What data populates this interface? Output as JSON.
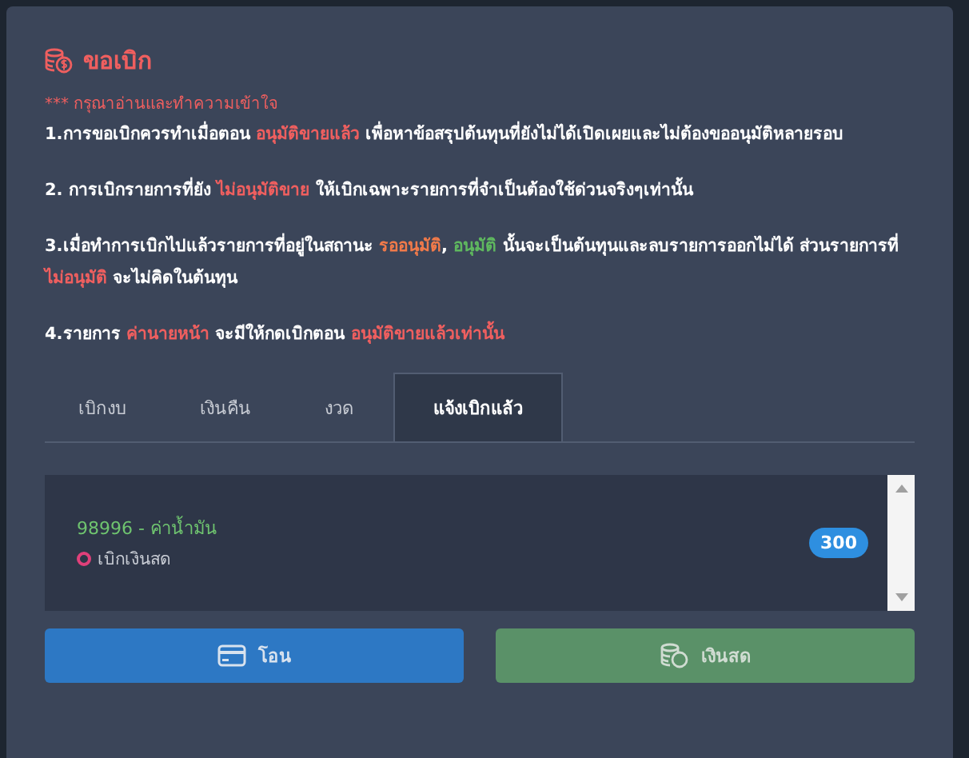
{
  "modal": {
    "title": "ขอเบิก",
    "warning": "*** กรุณาอ่านและทำความเข้าใจ",
    "notes": [
      {
        "parts": [
          {
            "text": "1.การขอเบิกควรทำเมื่อตอน "
          },
          {
            "text": "อนุมัติขายแล้ว",
            "color": "#ef5f5f"
          },
          {
            "text": " เพื่อหาข้อสรุปต้นทุนที่ยังไม่ได้เปิดเผยและไม่ต้องขออนุมัติหลายรอบ"
          }
        ]
      },
      {
        "parts": [
          {
            "text": "2. การเบิกรายการที่ยัง "
          },
          {
            "text": "ไม่อนุมัติขาย",
            "color": "#ef5f5f"
          },
          {
            "text": " ให้เบิกเฉพาะรายการที่จำเป็นต้องใช้ด่วนจริงๆเท่านั้น"
          }
        ]
      },
      {
        "parts": [
          {
            "text": "3.เมื่อทำการเบิกไปแล้วรายการที่อยู่ในสถานะ "
          },
          {
            "text": "รออนุมัติ",
            "color": "#f07a4a"
          },
          {
            "text": ", "
          },
          {
            "text": "อนุมัติ",
            "color": "#5fb85f"
          },
          {
            "text": " นั้นจะเป็นต้นทุนและลบรายการออกไม่ได้ ส่วนรายการที่ "
          },
          {
            "text": "ไม่อนุมัติ",
            "color": "#ef5f5f"
          },
          {
            "text": " จะไม่คิดในต้นทุน"
          }
        ]
      },
      {
        "parts": [
          {
            "text": "4.รายการ "
          },
          {
            "text": "ค่านายหน้า",
            "color": "#ef5f5f"
          },
          {
            "text": " จะมีให้กดเบิกตอน "
          },
          {
            "text": "อนุมัติขายแล้วเท่านั้น",
            "color": "#ef5f5f"
          }
        ]
      }
    ],
    "tabs": [
      {
        "label": "เบิกงบ",
        "selected": false
      },
      {
        "label": "เงินคืน",
        "selected": false
      },
      {
        "label": "งวด",
        "selected": false
      },
      {
        "label": "แจ้งเบิกแล้ว",
        "selected": true
      }
    ],
    "items": [
      {
        "title": "98996 - ค่าน้ำมัน",
        "status": "เบิกเงินสด",
        "color": "#e0407a",
        "amount": "300"
      }
    ],
    "buttons": [
      {
        "label": "โอน",
        "kind": "transfer"
      },
      {
        "label": "เงินสด",
        "kind": "cash"
      }
    ]
  }
}
